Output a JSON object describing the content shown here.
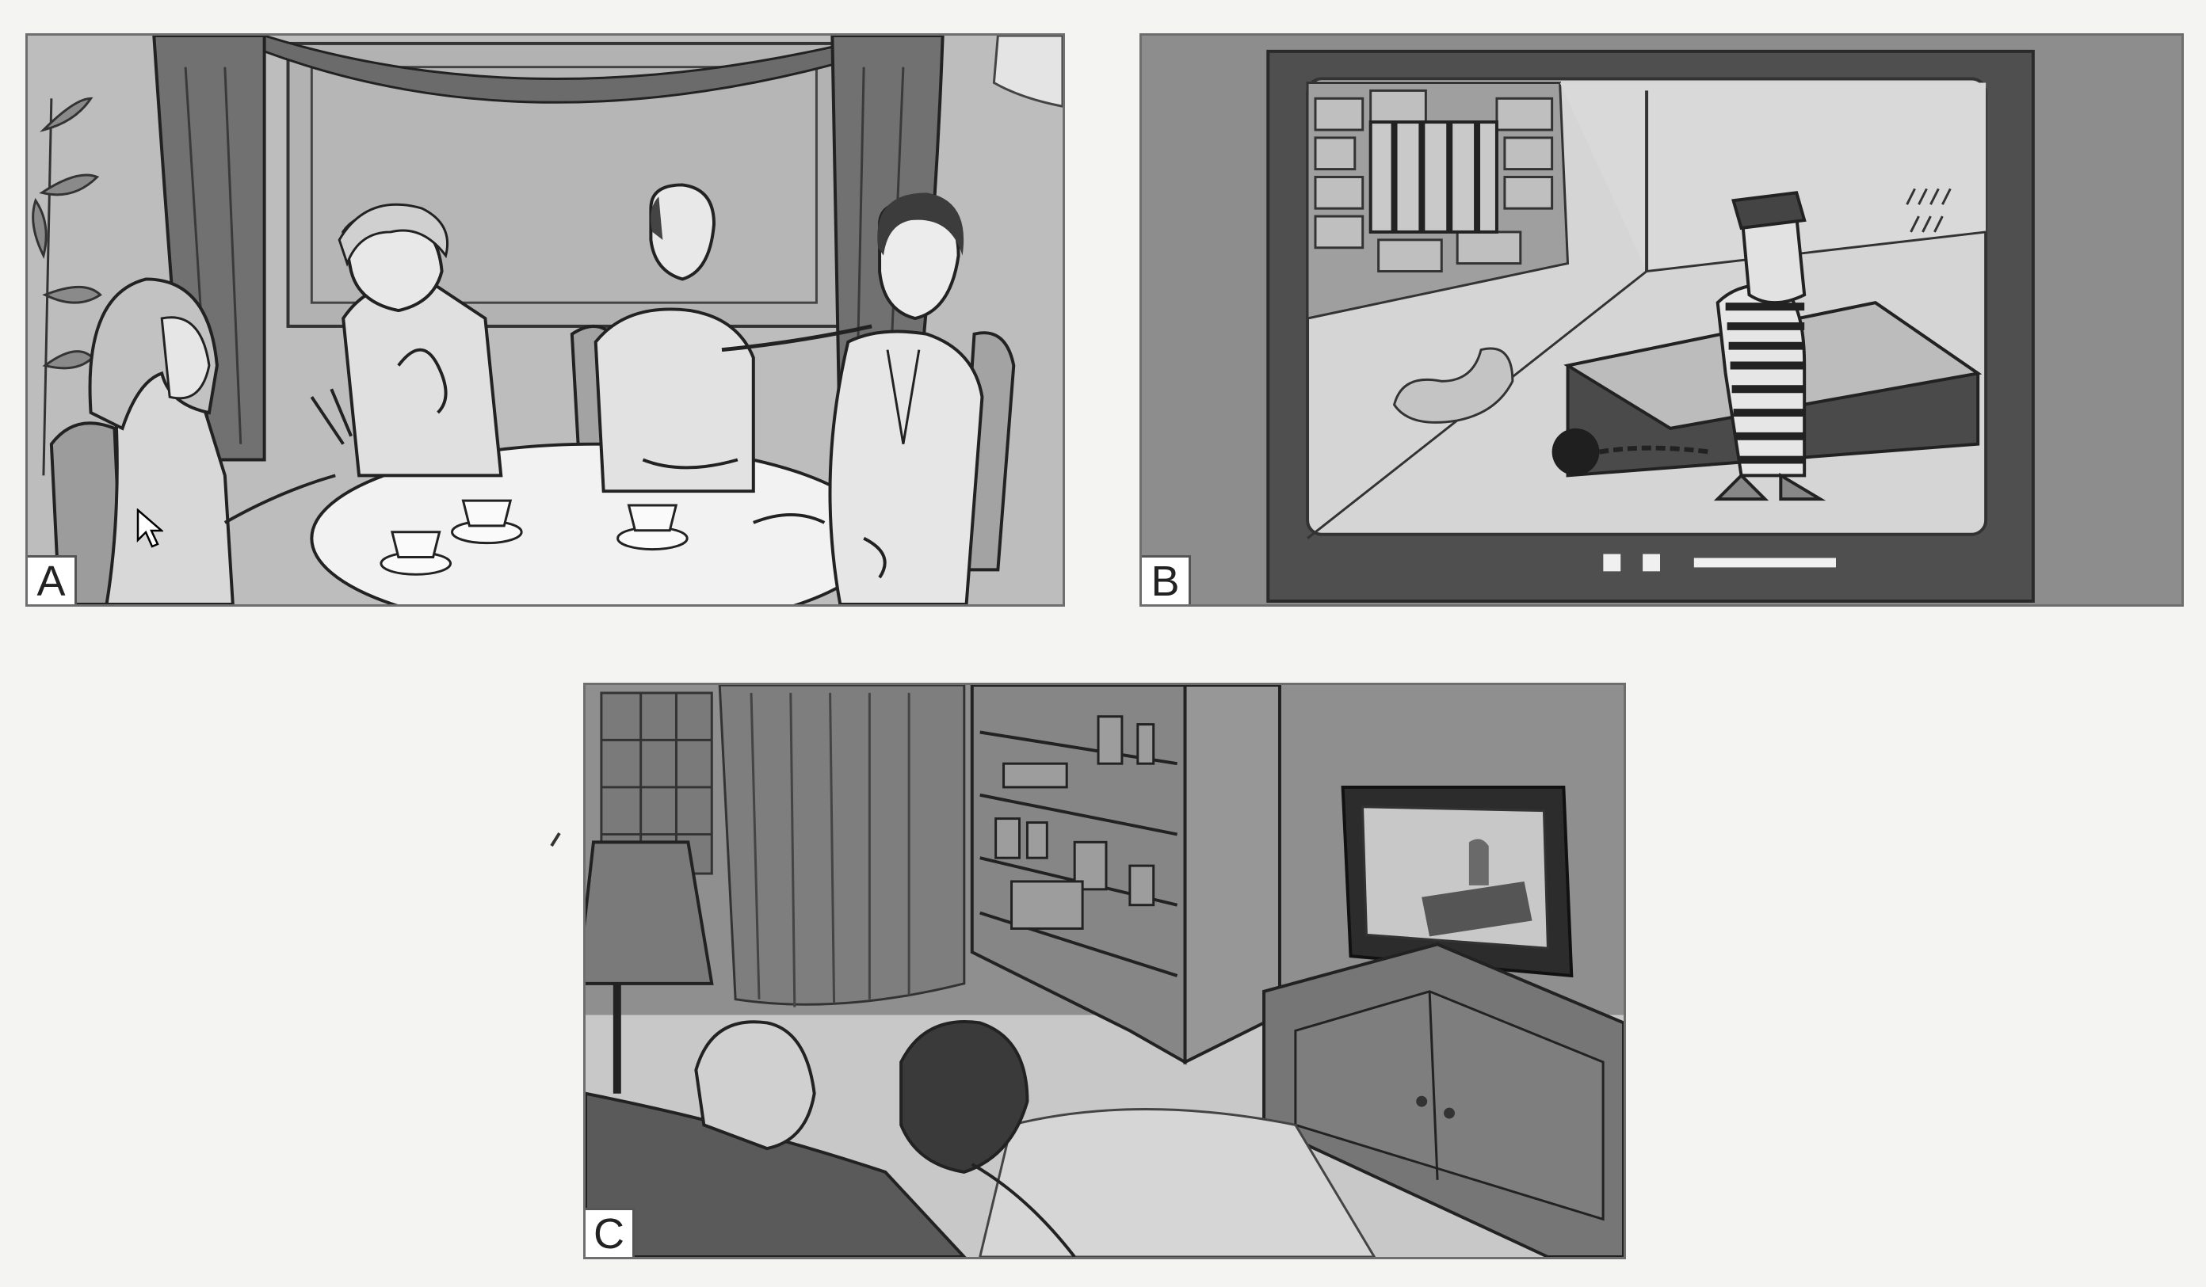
{
  "panels": [
    {
      "id": "A",
      "label": "A"
    },
    {
      "id": "B",
      "label": "B"
    },
    {
      "id": "C",
      "label": "C"
    }
  ],
  "colors": {
    "background": "#f4f4f2",
    "ink": "#222222",
    "panel_a_wall": "#bdbdbd",
    "panel_b_bezel": "#555555",
    "panel_c_room": "#c8c8c8"
  },
  "icons": [
    "mouse-cursor-icon"
  ]
}
